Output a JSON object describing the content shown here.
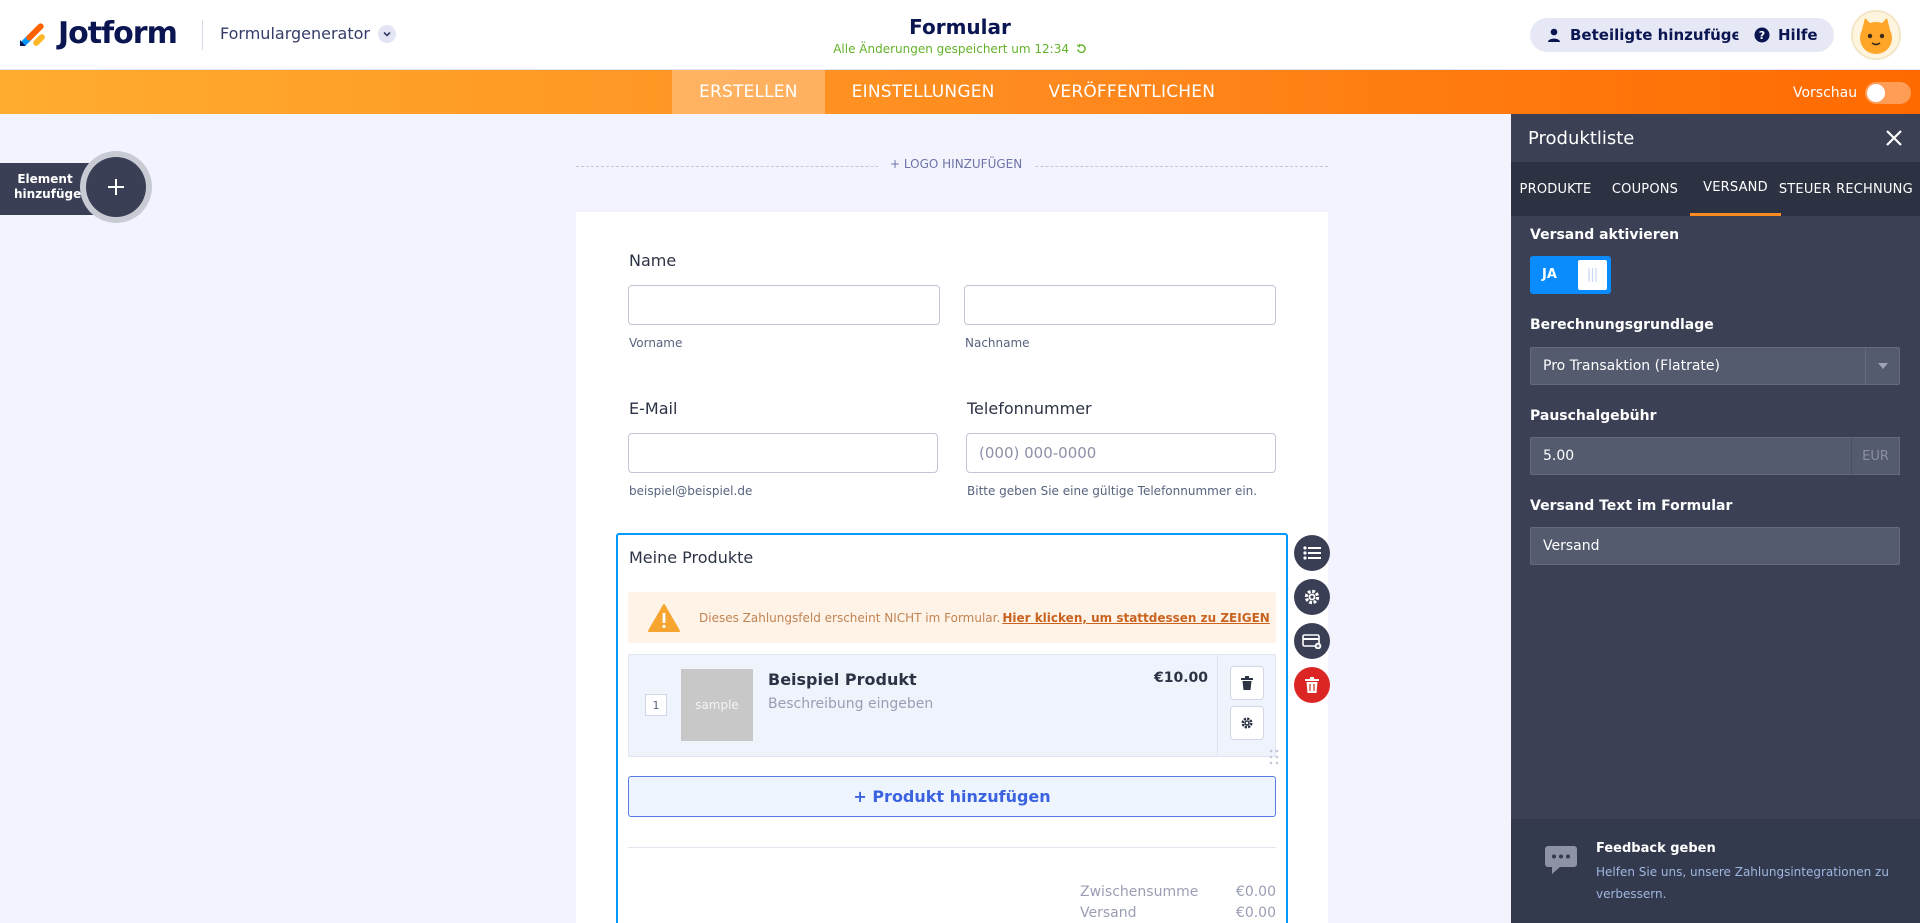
{
  "app": {
    "brand": "Jotform",
    "builder_menu": "Formulargenerator",
    "form_title": "Formular",
    "saved_status": "Alle Änderungen gespeichert um 12:34",
    "invite_button": "Beteiligte hinzufügen",
    "help_button": "Hilfe"
  },
  "nav": {
    "tabs": [
      "ERSTELLEN",
      "EINSTELLUNGEN",
      "VERÖFFENTLICHEN"
    ],
    "active_tab": "ERSTELLEN",
    "preview_label": "Vorschau"
  },
  "left": {
    "add_element": "Element hinzufügen"
  },
  "form": {
    "logo_add": "+ LOGO HINZUFÜGEN",
    "name_label": "Name",
    "firstname_sub": "Vorname",
    "lastname_sub": "Nachname",
    "email_label": "E-Mail",
    "email_sub": "beispiel@beispiel.de",
    "phone_label": "Telefonnummer",
    "phone_placeholder": "(000) 000-0000",
    "phone_sub": "Bitte geben Sie eine gültige Telefonnummer ein.",
    "products_title": "Meine Produkte",
    "warning_text": "Dieses Zahlungsfeld erscheint NICHT im Formular.",
    "warning_link": "Hier klicken, um stattdessen zu ZEIGEN",
    "product": {
      "qty": "1",
      "image_text": "sample",
      "name": "Beispiel Produkt",
      "description_placeholder": "Beschreibung eingeben",
      "price": "€10.00"
    },
    "add_product": "+ Produkt hinzufügen",
    "totals": [
      {
        "label": "Zwischensumme",
        "value": "€0.00"
      },
      {
        "label": "Versand",
        "value": "€0.00"
      }
    ]
  },
  "panel": {
    "title": "Produktliste",
    "tabs": [
      "PRODUKTE",
      "COUPONS",
      "VERSAND",
      "STEUER",
      "RECHNUNG"
    ],
    "active_tab": "VERSAND",
    "shipping_enable_label": "Versand aktivieren",
    "toggle_value": "JA",
    "calc_label": "Berechnungsgrundlage",
    "calc_value": "Pro Transaktion (Flatrate)",
    "flat_fee_label": "Pauschalgebühr",
    "flat_fee_value": "5.00",
    "currency": "EUR",
    "shipping_text_label": "Versand Text im Formular",
    "shipping_text_value": "Versand",
    "feedback_title": "Feedback geben",
    "feedback_text": "Helfen Sie uns, unsere Zahlungsintegrationen zu verbessern."
  },
  "colors": {
    "accent_orange": "#ff8a1f",
    "brand_navy": "#0a1551",
    "selected_blue": "#0099ff",
    "delete_red": "#dc2626",
    "saved_green": "#64b22a"
  }
}
